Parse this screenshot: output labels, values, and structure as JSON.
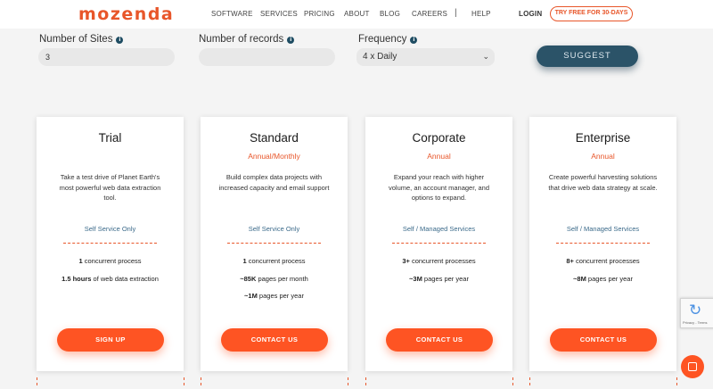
{
  "brand": {
    "logo": "mozenda",
    "accent": "#e8562a",
    "dark": "#2b5368"
  },
  "nav": {
    "links": [
      "SOFTWARE",
      "SERVICES",
      "PRICING",
      "ABOUT",
      "BLOG",
      "CAREERS"
    ],
    "separator": "|",
    "help": "HELP",
    "login": "LOGIN",
    "cta": "TRY FREE FOR 30-DAYS"
  },
  "form": {
    "sites": {
      "label": "Number of Sites",
      "value": "3",
      "info_icon": "info-icon"
    },
    "records": {
      "label": "Number of records",
      "value": "",
      "info_icon": "info-icon"
    },
    "frequency": {
      "label": "Frequency",
      "selected": "4 x Daily",
      "info_icon": "info-icon"
    },
    "suggest": "SUGGEST"
  },
  "plans": [
    {
      "title": "Trial",
      "subtitle": "",
      "description": "Take a test drive of Planet Earth's most powerful web data extraction tool.",
      "service": "Self Service Only",
      "features": [
        {
          "bold": "1",
          "text": " concurrent process"
        },
        {
          "bold": "1.5 hours",
          "text": " of web data extraction"
        }
      ],
      "button": "SIGN UP"
    },
    {
      "title": "Standard",
      "subtitle": "Annual/Monthly",
      "description": "Build complex data projects with increased capacity and email support",
      "service": "Self Service Only",
      "features": [
        {
          "bold": "1",
          "text": " concurrent process"
        },
        {
          "bold": "~85K",
          "text": " pages per month"
        },
        {
          "bold": "~1M",
          "text": " pages per year"
        }
      ],
      "button": "CONTACT US"
    },
    {
      "title": "Corporate",
      "subtitle": "Annual",
      "description": "Expand your reach with higher volume, an account manager, and options to expand.",
      "service": "Self / Managed Services",
      "features": [
        {
          "bold": "3+",
          "text": " concurrent processes"
        },
        {
          "bold": "~3M",
          "text": " pages per year"
        }
      ],
      "button": "CONTACT US"
    },
    {
      "title": "Enterprise",
      "subtitle": "Annual",
      "description": "Create powerful harvesting solutions that drive web data strategy at scale.",
      "service": "Self / Managed Services",
      "features": [
        {
          "bold": "8+",
          "text": " concurrent processes"
        },
        {
          "bold": "~8M",
          "text": " pages per year"
        }
      ],
      "button": "CONTACT US"
    }
  ],
  "widgets": {
    "recaptcha": {
      "icon": "recaptcha-icon",
      "text": "Privacy - Terms"
    },
    "chat": {
      "icon": "chat-icon"
    }
  }
}
